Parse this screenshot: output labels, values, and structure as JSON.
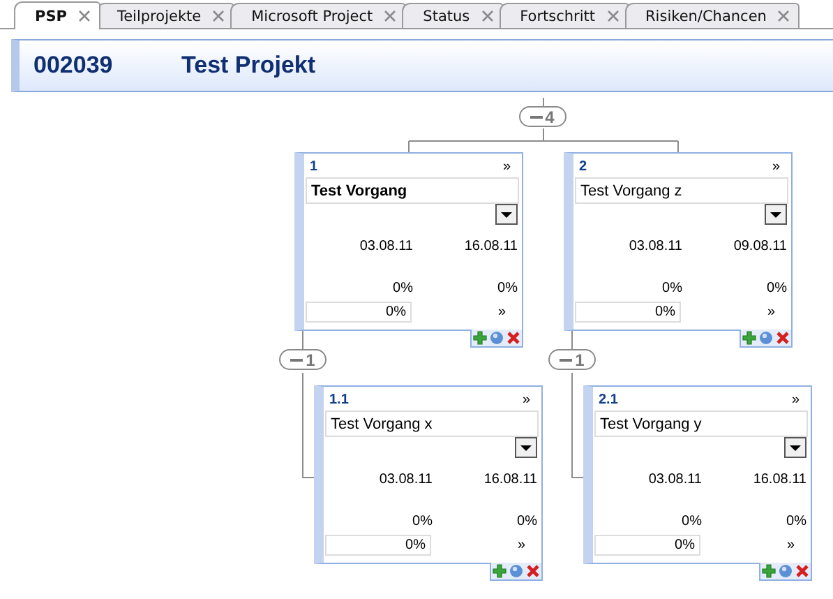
{
  "tabs": [
    {
      "label": "PSP",
      "selected": true
    },
    {
      "label": "Teilprojekte",
      "selected": false
    },
    {
      "label": "Microsoft Project",
      "selected": false
    },
    {
      "label": "Status",
      "selected": false
    },
    {
      "label": "Fortschritt",
      "selected": false
    },
    {
      "label": "Risiken/Chancen",
      "selected": false
    }
  ],
  "project": {
    "number": "002039",
    "title": "Test Projekt",
    "expanded": true,
    "count": "4",
    "children": [
      {
        "number": "1",
        "header_link": "»",
        "title": "Test Vorgang",
        "selected": true,
        "start": "03.08.11",
        "end": "16.08.11",
        "progress_planned": "0%",
        "progress_actual": "0%",
        "progress_input": "0%",
        "footer_link": "»",
        "expanded": true,
        "count": "1",
        "children": [
          {
            "number": "1.1",
            "header_link": "»",
            "title": "Test Vorgang x",
            "selected": false,
            "start": "03.08.11",
            "end": "16.08.11",
            "progress_planned": "0%",
            "progress_actual": "0%",
            "progress_input": "0%",
            "footer_link": "»"
          }
        ]
      },
      {
        "number": "2",
        "header_link": "»",
        "title": "Test Vorgang z",
        "selected": false,
        "start": "03.08.11",
        "end": "09.08.11",
        "progress_planned": "0%",
        "progress_actual": "0%",
        "progress_input": "0%",
        "footer_link": "»",
        "expanded": true,
        "count": "1",
        "children": [
          {
            "number": "2.1",
            "header_link": "»",
            "title": "Test Vorgang y",
            "selected": false,
            "start": "03.08.11",
            "end": "16.08.11",
            "progress_planned": "0%",
            "progress_actual": "0%",
            "progress_input": "0%",
            "footer_link": "»"
          }
        ]
      }
    ]
  }
}
